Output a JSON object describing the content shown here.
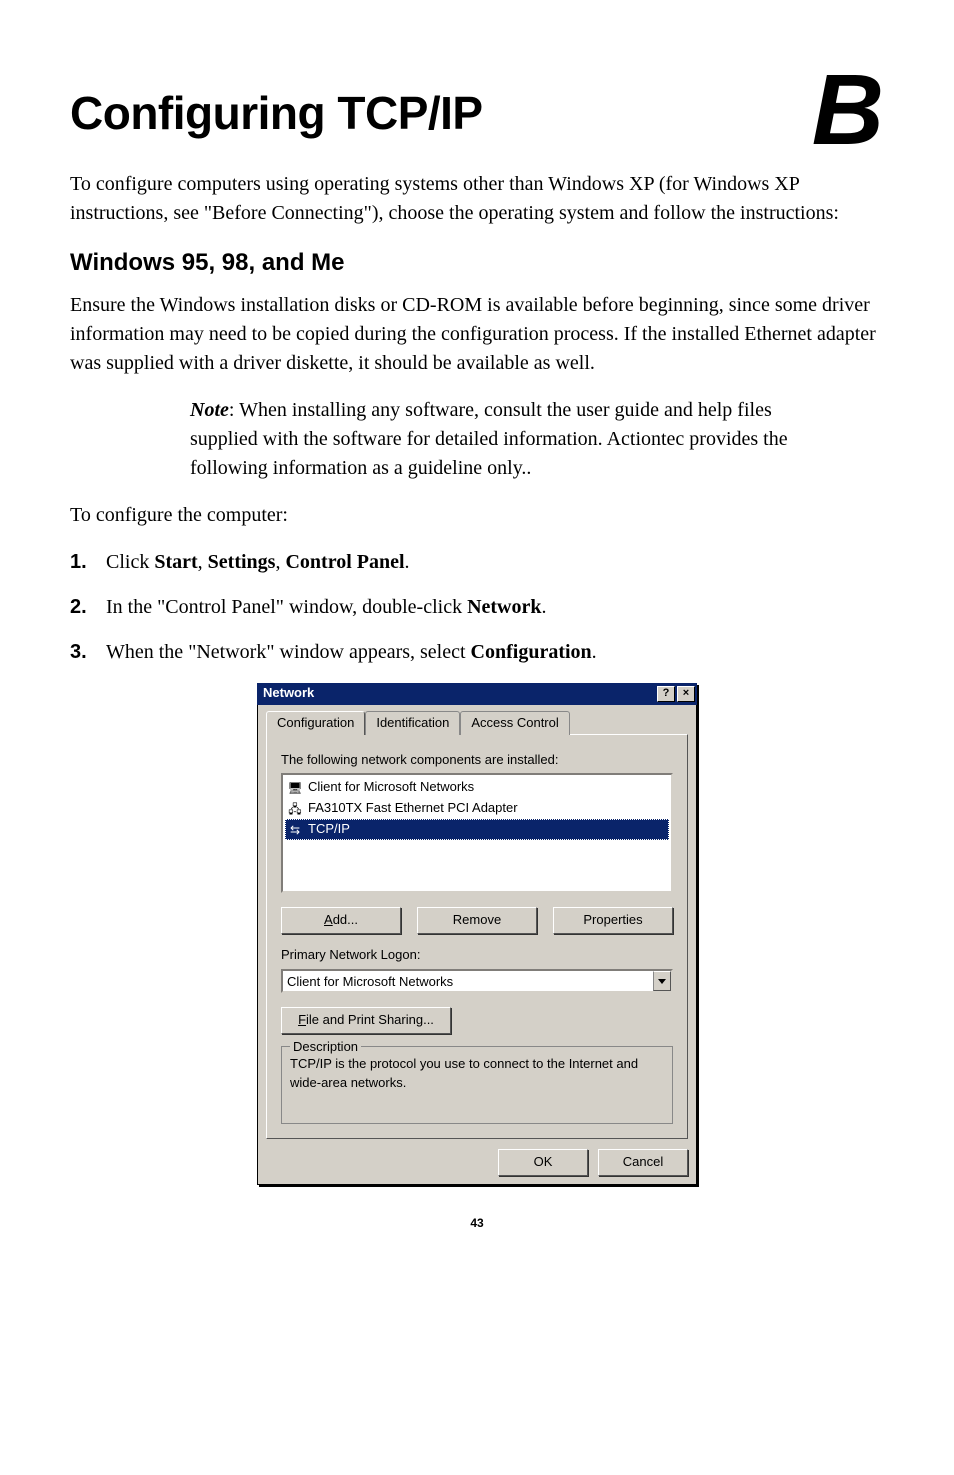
{
  "page": {
    "title": "Configuring TCP/IP",
    "appendix_letter": "B",
    "lead": "To configure computers using operating systems other than Windows XP (for Windows XP instructions, see \"Before Connecting\"), choose the operating system and follow the instructions:",
    "section_heading": "Windows 95, 98, and Me",
    "section_intro": "Ensure the Windows installation disks or CD-ROM is available before beginning, since some driver information may need to be copied during the configuration process. If the installed Ethernet adapter was supplied with a driver diskette, it should be available as well.",
    "note_label": "Note",
    "note_body": ": When installing any software, consult the user guide and help files supplied with the software for detailed information. Actiontec provides the following information as a guideline only..",
    "configure_lead": "To configure the computer:",
    "steps": [
      {
        "pre": "Click ",
        "bold1": "Start",
        "mid1": ", ",
        "bold2": "Settings",
        "mid2": ", ",
        "bold3": "Control Panel",
        "post": "."
      },
      {
        "pre": "In the \"Control Panel\" window, double-click ",
        "bold1": "Network",
        "post": "."
      },
      {
        "pre": "When the \"Network\" window appears, select ",
        "bold1": "Configuration",
        "post": "."
      }
    ],
    "page_number": "43"
  },
  "dialog": {
    "title": "Network",
    "tabs": [
      "Configuration",
      "Identification",
      "Access Control"
    ],
    "components_label": "The following network components are installed:",
    "components": [
      {
        "icon": "computer-icon",
        "text": "Client for Microsoft Networks",
        "selected": false
      },
      {
        "icon": "adapter-icon",
        "text": "FA310TX Fast Ethernet PCI Adapter",
        "selected": false
      },
      {
        "icon": "protocol-icon",
        "text": "TCP/IP",
        "selected": true
      }
    ],
    "buttons": {
      "add": "Add...",
      "remove": "Remove",
      "properties": "Properties"
    },
    "primary_logon_label": "Primary Network Logon:",
    "primary_logon_value": "Client for Microsoft Networks",
    "file_print_btn": "File and Print Sharing...",
    "description_legend": "Description",
    "description_text": "TCP/IP is the protocol you use to connect to the Internet and wide-area networks.",
    "ok": "OK",
    "cancel": "Cancel"
  }
}
